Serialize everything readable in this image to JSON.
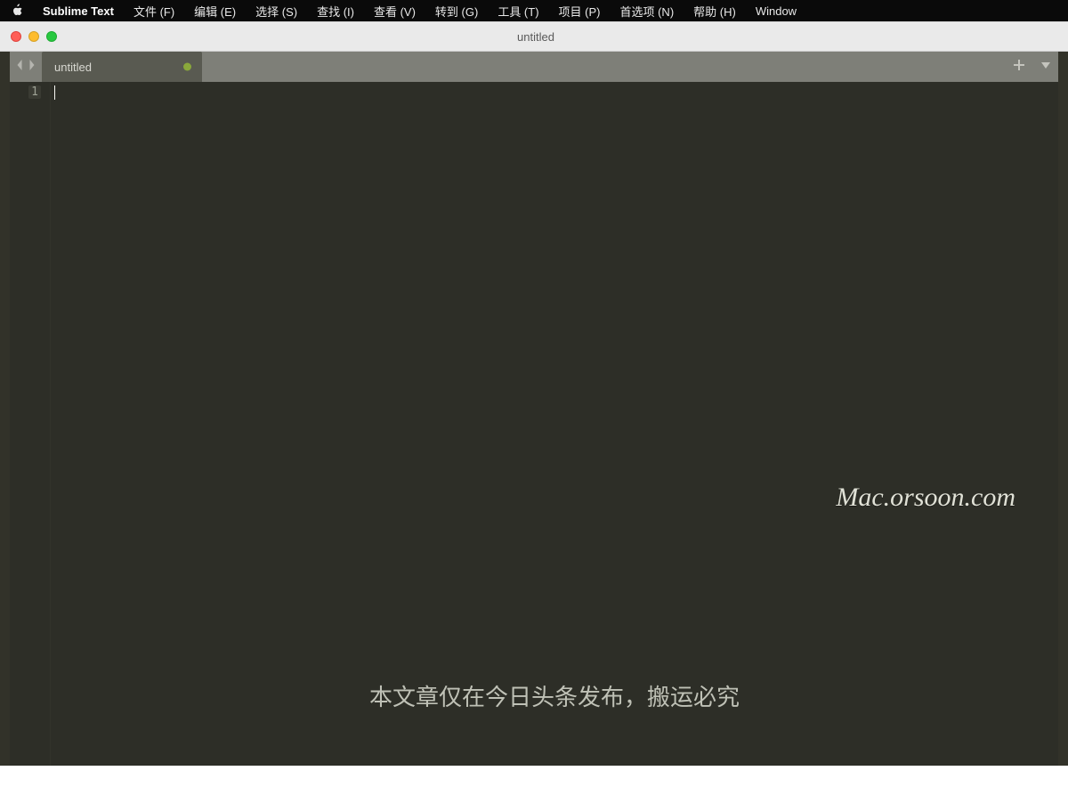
{
  "menubar": {
    "app_name": "Sublime Text",
    "items": [
      "文件 (F)",
      "编辑 (E)",
      "选择 (S)",
      "查找 (I)",
      "查看 (V)",
      "转到 (G)",
      "工具 (T)",
      "项目 (P)",
      "首选项 (N)",
      "帮助 (H)",
      "Window"
    ]
  },
  "window": {
    "title": "untitled"
  },
  "tabs": {
    "active": {
      "label": "untitled",
      "dirty": true
    }
  },
  "editor": {
    "line_number": "1",
    "content": ""
  },
  "watermarks": {
    "site": "Mac.orsoon.com",
    "notice": "本文章仅在今日头条发布，搬运必究"
  },
  "colors": {
    "editor_bg": "#2d2e27",
    "tabbar_bg": "#7e7f78",
    "active_tab_bg": "#595a51",
    "dirty_dot": "#8aa83b"
  }
}
